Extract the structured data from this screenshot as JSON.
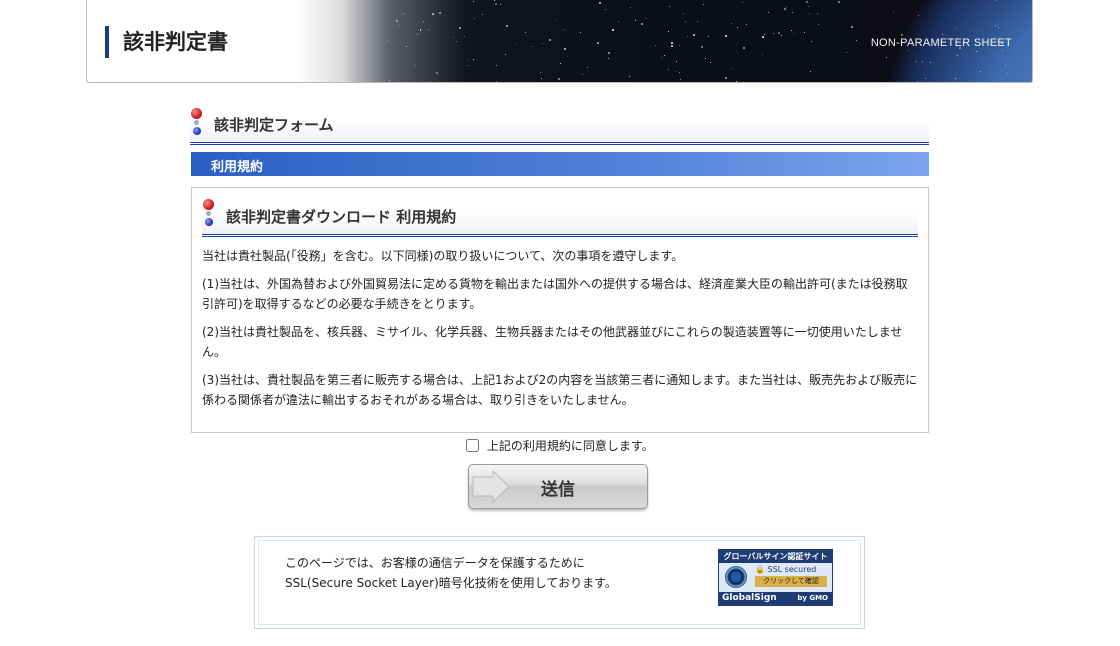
{
  "header": {
    "title": "該非判定書",
    "subtitle": "NON-PARAMETER SHEET"
  },
  "form": {
    "heading": "該非判定フォーム",
    "bar_label": "利用規約"
  },
  "terms": {
    "heading": "該非判定書ダウンロード 利用規約",
    "paragraphs": [
      "当社は貴社製品(「役務」を含む。以下同様)の取り扱いについて、次の事項を遵守します。",
      "(1)当社は、外国為替および外国貿易法に定める貨物を輸出または国外への提供する場合は、経済産業大臣の輸出許可(または役務取引許可)を取得するなどの必要な手続きをとります。",
      "(2)当社は貴社製品を、核兵器、ミサイル、化学兵器、生物兵器またはその他武器並びにこれらの製造装置等に一切使用いたしません。",
      "(3)当社は、貴社製品を第三者に販売する場合は、上記1および2の内容を当該第三者に通知します。また当社は、販売先および販売に係わる関係者が違法に輸出するおそれがある場合は、取り引きをいたしません。"
    ]
  },
  "agree": {
    "label": "上記の利用規約に同意します。",
    "checked": false
  },
  "submit": {
    "label": "送信"
  },
  "ssl": {
    "line1": "このページでは、お客様の通信データを保護するために",
    "line2": "SSL(Secure Socket Layer)暗号化技術を使用しております。",
    "seal": {
      "top": "グローバルサイン認証サイト",
      "secured": "SSL secured",
      "click": "クリックして確認",
      "brand": "GlobalSign",
      "by": "by GMO"
    }
  },
  "colors": {
    "accent_blue": "#1c3fae",
    "bar_blue": "#3b6fd0",
    "seal_navy": "#1f3c75"
  }
}
